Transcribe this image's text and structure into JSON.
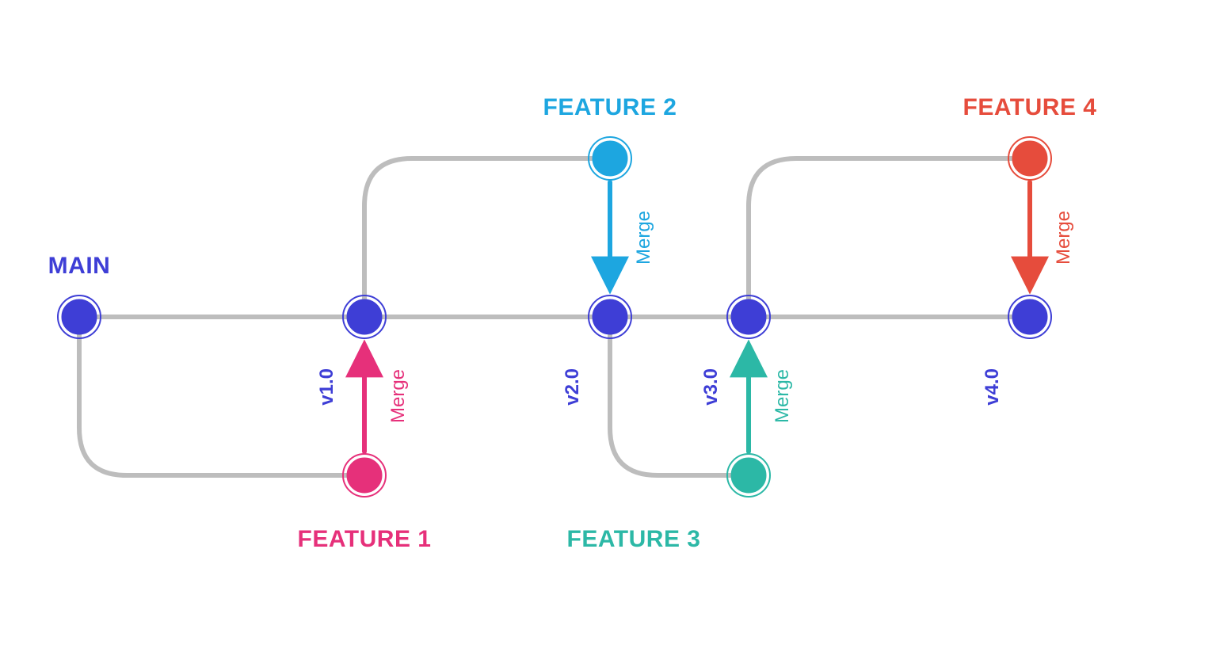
{
  "colors": {
    "main": "#3E3ED6",
    "feature1": "#E6307A",
    "feature2": "#1DA6E0",
    "feature3": "#2CB8A6",
    "feature4": "#E64C3C",
    "line": "#BDBDBD"
  },
  "labels": {
    "main": "MAIN",
    "feature1": "FEATURE 1",
    "feature2": "FEATURE 2",
    "feature3": "FEATURE 3",
    "feature4": "FEATURE 4",
    "merge": "Merge"
  },
  "versions": {
    "v1": "v1.0",
    "v2": "v2.0",
    "v3": "v3.0",
    "v4": "v4.0"
  }
}
